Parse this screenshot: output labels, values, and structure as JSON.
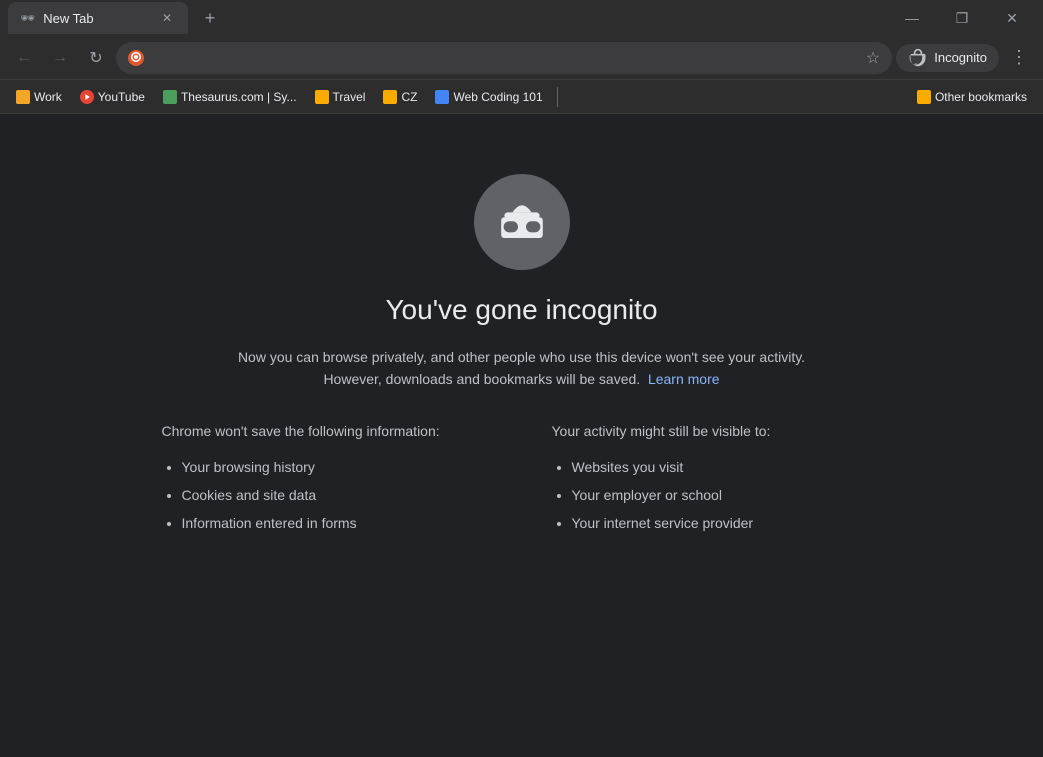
{
  "window": {
    "title": "New Tab",
    "controls": {
      "minimize": "—",
      "maximize": "❐",
      "close": "✕"
    }
  },
  "tab": {
    "label": "New Tab",
    "close": "✕"
  },
  "nav": {
    "back": "←",
    "forward": "→",
    "refresh": "↻",
    "address_placeholder": "",
    "address_value": "",
    "bookmark": "☆",
    "incognito_label": "Incognito",
    "more": "⋮"
  },
  "bookmarks": [
    {
      "id": "work",
      "label": "Work",
      "color": "orange"
    },
    {
      "id": "youtube",
      "label": "YouTube",
      "color": "red"
    },
    {
      "id": "thesaurus",
      "label": "Thesaurus.com | Sy...",
      "color": "green"
    },
    {
      "id": "travel",
      "label": "Travel",
      "color": "yellow"
    },
    {
      "id": "cz",
      "label": "CZ",
      "color": "yellow2"
    },
    {
      "id": "webcoding",
      "label": "Web Coding 101",
      "color": "blue"
    },
    {
      "id": "other",
      "label": "Other bookmarks",
      "color": "yellow3"
    }
  ],
  "incognito_page": {
    "title": "You've gone incognito",
    "description_line1": "Now you can browse privately, and other people who use this device won't see your activity.",
    "description_line2": "However, downloads and bookmarks will be saved.",
    "learn_more": "Learn more",
    "col1_title": "Chrome won't save the following information:",
    "col1_items": [
      "Your browsing history",
      "Cookies and site data",
      "Information entered in forms"
    ],
    "col2_title": "Your activity might still be visible to:",
    "col2_items": [
      "Websites you visit",
      "Your employer or school",
      "Your internet service provider"
    ]
  }
}
